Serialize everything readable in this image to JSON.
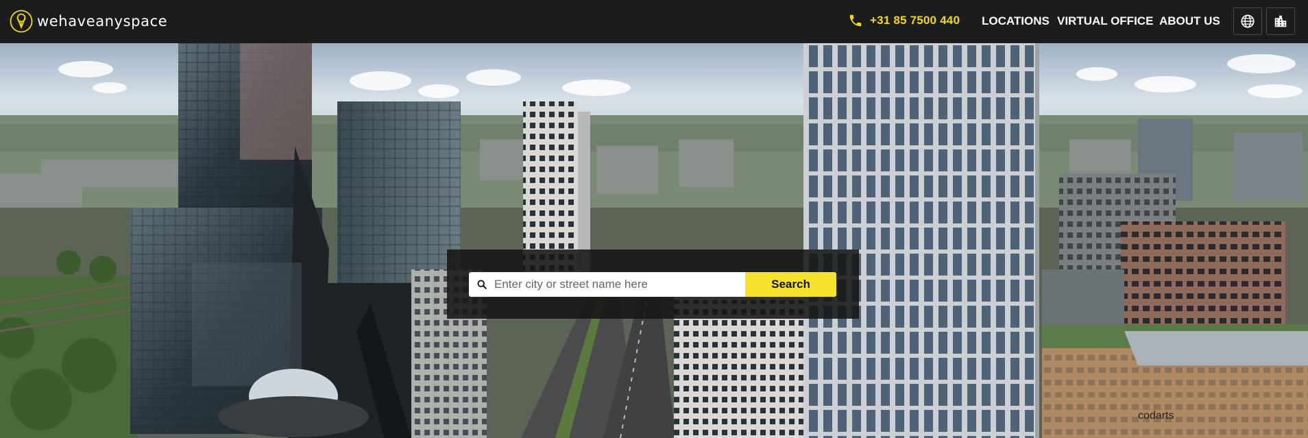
{
  "brand": {
    "name": "wehaveanyspace"
  },
  "header": {
    "phone": "+31 85 7500 440",
    "nav": [
      "LOCATIONS",
      "VIRTUAL OFFICE",
      "ABOUT US"
    ]
  },
  "search": {
    "placeholder": "Enter city or street name here",
    "value": "",
    "button_label": "Search"
  },
  "hero": {
    "signage": "codarts"
  },
  "colors": {
    "accent": "#f5e22a",
    "header_bg": "#1b1c1e",
    "phone": "#f5d90a"
  },
  "icons": [
    "logo-icon",
    "phone-icon",
    "globe-icon",
    "building-icon",
    "search-icon"
  ]
}
